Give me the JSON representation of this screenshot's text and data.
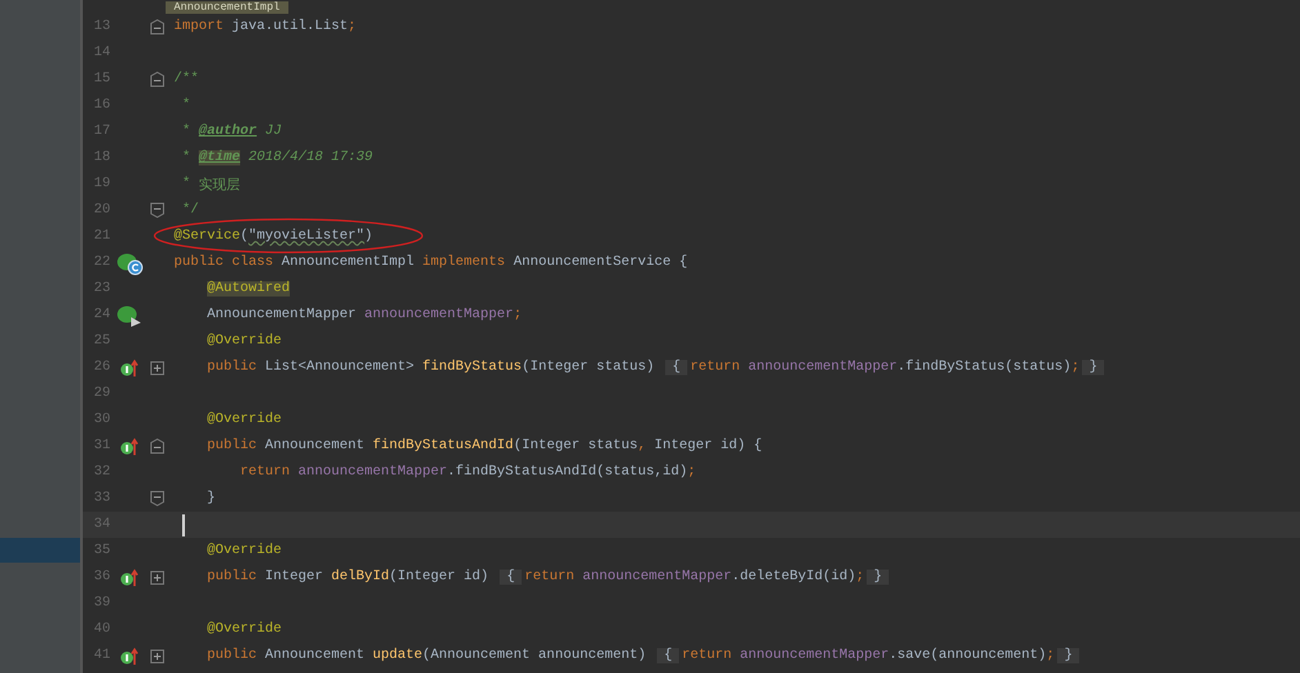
{
  "file_tag": "AnnouncementImpl",
  "lines": [
    {
      "number": "13",
      "fold": {
        "kind": "open"
      },
      "tokens": [
        {
          "text": "import",
          "kind": "keyword"
        },
        {
          "text": " java.util.List",
          "kind": "plain"
        },
        {
          "text": ";",
          "kind": "keyword"
        }
      ]
    },
    {
      "number": "14"
    },
    {
      "number": "15",
      "fold": {
        "kind": "open"
      },
      "tokens": [
        {
          "text": "/**",
          "kind": "doc"
        }
      ]
    },
    {
      "number": "16",
      "tokens": [
        {
          "text": " *",
          "kind": "doc"
        }
      ]
    },
    {
      "number": "17",
      "tokens": [
        {
          "text": " * ",
          "kind": "doc"
        },
        {
          "text": "@author",
          "kind": "doc_tag"
        },
        {
          "text": " JJ",
          "kind": "doc_italic"
        }
      ]
    },
    {
      "number": "18",
      "tokens": [
        {
          "text": " * ",
          "kind": "doc"
        },
        {
          "text": "@time",
          "kind": "doc_tag_highlight"
        },
        {
          "text": " 2018/4/18 17:39",
          "kind": "doc_italic"
        }
      ]
    },
    {
      "number": "19",
      "tokens": [
        {
          "text": " * ",
          "kind": "doc"
        },
        {
          "text": "实现层",
          "kind": "doc"
        }
      ]
    },
    {
      "number": "20",
      "fold": {
        "kind": "close"
      },
      "tokens": [
        {
          "text": " */",
          "kind": "doc"
        }
      ]
    },
    {
      "number": "21",
      "tokens": [
        {
          "text": "@Service",
          "kind": "annotation"
        },
        {
          "text": "(",
          "kind": "plain"
        },
        {
          "text": "\"myovieLister\"",
          "kind": "typo"
        },
        {
          "text": ")",
          "kind": "plain"
        }
      ]
    },
    {
      "number": "22",
      "gutter_icon": {
        "kind": "class"
      },
      "tokens": [
        {
          "text": "public class ",
          "kind": "keyword"
        },
        {
          "text": "AnnouncementImpl ",
          "kind": "plain"
        },
        {
          "text": "implements ",
          "kind": "keyword"
        },
        {
          "text": "AnnouncementService {",
          "kind": "plain"
        }
      ]
    },
    {
      "number": "23",
      "indent": {
        "kind": "member"
      },
      "tokens": [
        {
          "text": "@Autowired",
          "kind": "annotation_highlight"
        }
      ]
    },
    {
      "number": "24",
      "gutter_icon": {
        "kind": "autowired"
      },
      "indent": {
        "kind": "member"
      },
      "tokens": [
        {
          "text": "AnnouncementMapper ",
          "kind": "plain"
        },
        {
          "text": "announcementMapper",
          "kind": "field"
        },
        {
          "text": ";",
          "kind": "keyword"
        }
      ]
    },
    {
      "number": "25",
      "indent": {
        "kind": "member"
      },
      "tokens": [
        {
          "text": "@Override",
          "kind": "annotation"
        }
      ]
    },
    {
      "number": "26",
      "gutter_icon": {
        "kind": "implements"
      },
      "fold": {
        "kind": "collapsed"
      },
      "indent": {
        "kind": "member"
      },
      "tokens": [
        {
          "text": "public ",
          "kind": "keyword"
        },
        {
          "text": "List<Announcement> ",
          "kind": "plain"
        },
        {
          "text": "findByStatus",
          "kind": "method"
        },
        {
          "text": "(Integer status) ",
          "kind": "plain"
        },
        {
          "text": "{",
          "kind": "folded"
        },
        {
          "text": "return ",
          "kind": "keyword"
        },
        {
          "text": "announcementMapper",
          "kind": "field"
        },
        {
          "text": ".findByStatus(status)",
          "kind": "plain"
        },
        {
          "text": ";",
          "kind": "keyword"
        },
        {
          "text": "}",
          "kind": "folded"
        }
      ]
    },
    {
      "number": "29"
    },
    {
      "number": "30",
      "indent": {
        "kind": "member"
      },
      "tokens": [
        {
          "text": "@Override",
          "kind": "annotation"
        }
      ]
    },
    {
      "number": "31",
      "gutter_icon": {
        "kind": "implements"
      },
      "fold": {
        "kind": "open"
      },
      "indent": {
        "kind": "member"
      },
      "tokens": [
        {
          "text": "public ",
          "kind": "keyword"
        },
        {
          "text": "Announcement ",
          "kind": "plain"
        },
        {
          "text": "findByStatusAndId",
          "kind": "method"
        },
        {
          "text": "(Integer status",
          "kind": "plain"
        },
        {
          "text": ",",
          "kind": "keyword"
        },
        {
          "text": " Integer id) {",
          "kind": "plain"
        }
      ]
    },
    {
      "number": "32",
      "indent": {
        "kind": "body"
      },
      "tokens": [
        {
          "text": "return ",
          "kind": "keyword"
        },
        {
          "text": "announcementMapper",
          "kind": "field"
        },
        {
          "text": ".findByStatusAndId(status,id)",
          "kind": "plain"
        },
        {
          "text": ";",
          "kind": "keyword"
        }
      ]
    },
    {
      "number": "33",
      "fold": {
        "kind": "close"
      },
      "indent": {
        "kind": "member"
      },
      "tokens": [
        {
          "text": "}",
          "kind": "plain"
        }
      ]
    },
    {
      "number": "34",
      "current": true
    },
    {
      "number": "35",
      "indent": {
        "kind": "member"
      },
      "tokens": [
        {
          "text": "@Override",
          "kind": "annotation"
        }
      ]
    },
    {
      "number": "36",
      "gutter_icon": {
        "kind": "implements"
      },
      "fold": {
        "kind": "collapsed"
      },
      "indent": {
        "kind": "member"
      },
      "tokens": [
        {
          "text": "public ",
          "kind": "keyword"
        },
        {
          "text": "Integer ",
          "kind": "plain"
        },
        {
          "text": "delById",
          "kind": "method"
        },
        {
          "text": "(Integer id) ",
          "kind": "plain"
        },
        {
          "text": "{",
          "kind": "folded"
        },
        {
          "text": "return ",
          "kind": "keyword"
        },
        {
          "text": "announcementMapper",
          "kind": "field"
        },
        {
          "text": ".deleteById(id)",
          "kind": "plain"
        },
        {
          "text": ";",
          "kind": "keyword"
        },
        {
          "text": "}",
          "kind": "folded"
        }
      ]
    },
    {
      "number": "39"
    },
    {
      "number": "40",
      "indent": {
        "kind": "member"
      },
      "tokens": [
        {
          "text": "@Override",
          "kind": "annotation"
        }
      ]
    },
    {
      "number": "41",
      "gutter_icon": {
        "kind": "implements"
      },
      "fold": {
        "kind": "collapsed"
      },
      "indent": {
        "kind": "member"
      },
      "tokens": [
        {
          "text": "public ",
          "kind": "keyword"
        },
        {
          "text": "Announcement ",
          "kind": "plain"
        },
        {
          "text": "update",
          "kind": "method"
        },
        {
          "text": "(Announcement announcement) ",
          "kind": "plain"
        },
        {
          "text": "{",
          "kind": "folded"
        },
        {
          "text": "return ",
          "kind": "keyword"
        },
        {
          "text": "announcementMapper",
          "kind": "field"
        },
        {
          "text": ".save(announcement)",
          "kind": "plain"
        },
        {
          "text": ";",
          "kind": "keyword"
        },
        {
          "text": "}",
          "kind": "folded"
        }
      ]
    }
  ]
}
